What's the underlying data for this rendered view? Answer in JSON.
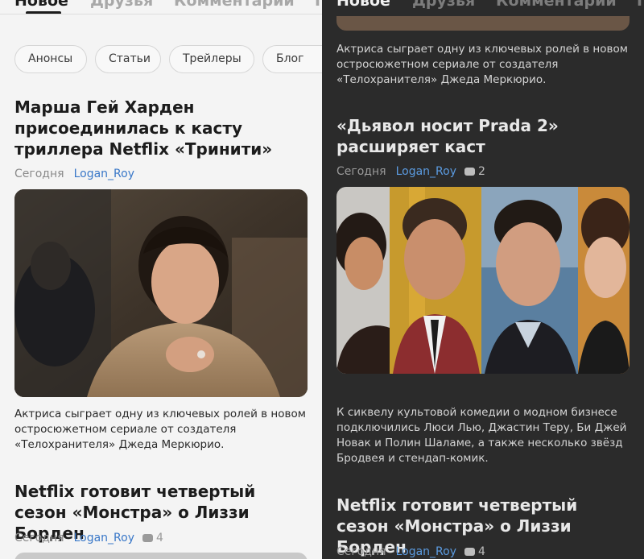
{
  "light": {
    "tabs": [
      "Новое",
      "Друзья",
      "Комментарии",
      "Тр"
    ],
    "chips": [
      "Анонсы",
      "Статьи",
      "Трейлеры",
      "Блог"
    ],
    "article1": {
      "title": "Марша Гей Харден присоединилась к касту триллера Netflix «Тринити»",
      "date": "Сегодня",
      "author": "Logan_Roy",
      "description": "Актриса сыграет одну из ключевых ролей в новом остросюжетном сериале от создателя «Телохранителя» Джеда Меркюрио."
    },
    "article2": {
      "title": "Netflix готовит четвертый сезон «Монстра» о Лиззи Борден",
      "date": "Сегодня",
      "author": "Logan_Roy",
      "comments": "4"
    }
  },
  "dark": {
    "tabs": [
      "Новое",
      "Друзья",
      "Комментарии",
      "Тр"
    ],
    "prev_description": "Актриса сыграет одну из ключевых ролей в новом остросюжетном сериале от создателя «Телохранителя» Джеда Меркюрио.",
    "article1": {
      "title": "«Дьявол носит Prada 2» расширяет каст",
      "date": "Сегодня",
      "author": "Logan_Roy",
      "comments": "2",
      "description": "К сиквелу культовой комедии о модном бизнесе подключились Люси Лью, Джастин Теру, Би Джей Новак и Полин Шаламе, а также несколько звёзд Бродвея и стендап-комик."
    },
    "article2": {
      "title": "Netflix готовит четвертый сезон «Монстра» о Лиззи Борден",
      "date": "Сегодня",
      "author": "Logan_Roy",
      "comments": "4"
    }
  },
  "icons": {
    "comment": "comment-bubble-icon"
  }
}
